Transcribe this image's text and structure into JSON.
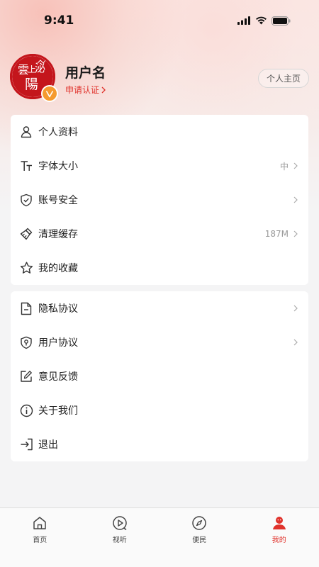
{
  "status_bar": {
    "time": "9:41"
  },
  "profile": {
    "avatar_text": "雲上泌陽",
    "username": "用户名",
    "verify_link": "申请认证",
    "homepage_button": "个人主页"
  },
  "menu_group_1": [
    {
      "label": "个人资料",
      "value": "",
      "chevron": false,
      "icon": "user-icon"
    },
    {
      "label": "字体大小",
      "value": "中",
      "chevron": true,
      "icon": "font-size-icon"
    },
    {
      "label": "账号安全",
      "value": "",
      "chevron": true,
      "icon": "shield-check-icon"
    },
    {
      "label": "清理缓存",
      "value": "187M",
      "chevron": true,
      "icon": "broom-icon"
    },
    {
      "label": "我的收藏",
      "value": "",
      "chevron": false,
      "icon": "star-icon"
    }
  ],
  "menu_group_2": [
    {
      "label": "隐私协议",
      "value": "",
      "chevron": true,
      "icon": "document-icon"
    },
    {
      "label": "用户协议",
      "value": "",
      "chevron": true,
      "icon": "shield-user-icon"
    },
    {
      "label": "意见反馈",
      "value": "",
      "chevron": false,
      "icon": "edit-icon"
    },
    {
      "label": "关于我们",
      "value": "",
      "chevron": false,
      "icon": "info-icon"
    },
    {
      "label": "退出",
      "value": "",
      "chevron": false,
      "icon": "logout-icon"
    }
  ],
  "tabbar": [
    {
      "label": "首页",
      "icon": "home-icon",
      "active": false
    },
    {
      "label": "视听",
      "icon": "play-icon",
      "active": false
    },
    {
      "label": "便民",
      "icon": "compass-icon",
      "active": false
    },
    {
      "label": "我的",
      "icon": "profile-icon",
      "active": true
    }
  ],
  "colors": {
    "accent": "#e0322b",
    "badge": "#f59a2f",
    "avatar_red": "#c4161c"
  }
}
